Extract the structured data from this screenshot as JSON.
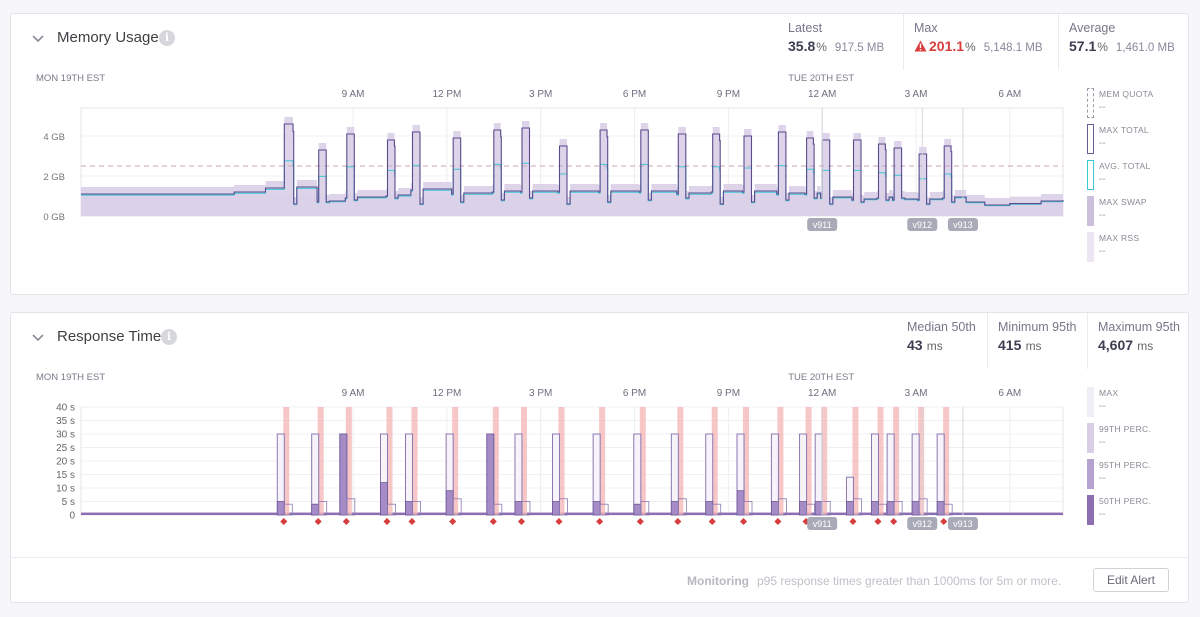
{
  "memory": {
    "title": "Memory Usage",
    "stats": [
      {
        "label": "Latest",
        "value": "35.8",
        "unit": "%",
        "extra": "917.5 MB",
        "alert": false
      },
      {
        "label": "Max",
        "value": "201.1",
        "unit": "%",
        "extra": "5,148.1 MB",
        "alert": true
      },
      {
        "label": "Average",
        "value": "57.1",
        "unit": "%",
        "extra": "1,461.0 MB",
        "alert": false
      }
    ],
    "legend": [
      {
        "label": "MEM QUOTA",
        "value": "--"
      },
      {
        "label": "MAX TOTAL",
        "value": "--"
      },
      {
        "label": "AVG. TOTAL",
        "value": "--"
      },
      {
        "label": "MAX SWAP",
        "value": "--"
      },
      {
        "label": "MAX RSS",
        "value": "--"
      }
    ],
    "y_ticks": [
      "4 GB",
      "2 GB",
      "0 GB"
    ]
  },
  "response": {
    "title": "Response Time",
    "stats": [
      {
        "label": "Median 50th",
        "value": "43",
        "unit": "ms"
      },
      {
        "label": "Minimum 95th",
        "value": "415",
        "unit": "ms"
      },
      {
        "label": "Maximum 95th",
        "value": "4,607",
        "unit": "ms"
      }
    ],
    "legend": [
      {
        "label": "MAX",
        "value": "--"
      },
      {
        "label": "99TH PERC.",
        "value": "--"
      },
      {
        "label": "95TH PERC.",
        "value": "--"
      },
      {
        "label": "50TH PERC.",
        "value": "--"
      }
    ],
    "y_ticks": [
      "40 s",
      "35 s",
      "30 s",
      "25 s",
      "20 s",
      "15 s",
      "10 s",
      "5 s",
      "0"
    ],
    "monitoring_label": "Monitoring",
    "monitoring_text": "p95 response times greater than 1000ms for 5m or more.",
    "edit_alert": "Edit Alert"
  },
  "time_axis": {
    "day_labels": [
      {
        "text": "MON 19TH EST",
        "hour": 0
      },
      {
        "text": "TUE 20TH EST",
        "hour": 24
      }
    ],
    "hour_labels": [
      {
        "text": "9 AM",
        "hour": 9
      },
      {
        "text": "12 PM",
        "hour": 12
      },
      {
        "text": "3 PM",
        "hour": 15
      },
      {
        "text": "6 PM",
        "hour": 18
      },
      {
        "text": "9 PM",
        "hour": 21
      },
      {
        "text": "12 AM",
        "hour": 24
      },
      {
        "text": "3 AM",
        "hour": 27
      },
      {
        "text": "6 AM",
        "hour": 30
      }
    ]
  },
  "releases": [
    {
      "label": "v911",
      "hour": 24.0
    },
    {
      "label": "v912",
      "hour": 27.2
    },
    {
      "label": "v913",
      "hour": 28.5
    }
  ],
  "chart_data": [
    {
      "type": "area",
      "title": "Memory Usage",
      "ylabel": "GB",
      "ylim": [
        0,
        5.4
      ],
      "series": [
        {
          "name": "MEM QUOTA",
          "values_note": "constant",
          "constant": 2.5
        },
        {
          "name": "MAX TOTAL"
        },
        {
          "name": "AVG. TOTAL"
        },
        {
          "name": "MAX SWAP"
        },
        {
          "name": "MAX RSS"
        }
      ],
      "spikes_hours": [
        6.8,
        7.9,
        8.8,
        10.1,
        10.9,
        12.2,
        13.5,
        14.4,
        15.6,
        16.9,
        18.2,
        19.4,
        20.5,
        21.5,
        22.6,
        23.5,
        24.0,
        25.0,
        25.8,
        26.3,
        27.1,
        27.9
      ],
      "spikes_gb": [
        4.6,
        3.3,
        4.1,
        3.8,
        4.2,
        3.9,
        4.3,
        4.4,
        3.5,
        4.3,
        4.3,
        4.1,
        4.1,
        4.0,
        4.2,
        3.9,
        3.8,
        3.8,
        3.6,
        3.4,
        3.1,
        3.5
      ],
      "baseline_gb": [
        1.4,
        0.7,
        0.9,
        1.0,
        1.3,
        1.1,
        1.2,
        1.2,
        1.2,
        1.2,
        1.2,
        1.1,
        1.2,
        1.2,
        1.1,
        1.1,
        0.9,
        0.8,
        0.9,
        0.8,
        0.8,
        0.9,
        0.8,
        1.0
      ]
    },
    {
      "type": "bar",
      "title": "Response Time",
      "ylabel": "s",
      "ylim": [
        0,
        40
      ],
      "series": [
        {
          "name": "MAX"
        },
        {
          "name": "99TH PERC."
        },
        {
          "name": "95TH PERC."
        },
        {
          "name": "50TH PERC."
        }
      ],
      "spikes_hours": [
        6.8,
        7.9,
        8.8,
        10.1,
        10.9,
        12.2,
        13.5,
        14.4,
        15.6,
        16.9,
        18.2,
        19.4,
        20.5,
        21.5,
        22.6,
        23.5,
        24.0,
        25.0,
        25.8,
        26.3,
        27.1,
        27.9
      ],
      "p99_s": [
        30,
        30,
        30,
        30,
        30,
        30,
        30,
        30,
        30,
        30,
        30,
        30,
        30,
        30,
        30,
        30,
        30,
        14,
        30,
        30,
        30,
        30
      ],
      "p95_s": [
        5,
        4,
        30,
        12,
        5,
        9,
        30,
        5,
        5,
        5,
        4,
        5,
        5,
        9,
        5,
        5,
        5,
        5,
        5,
        5,
        5,
        5
      ]
    }
  ]
}
